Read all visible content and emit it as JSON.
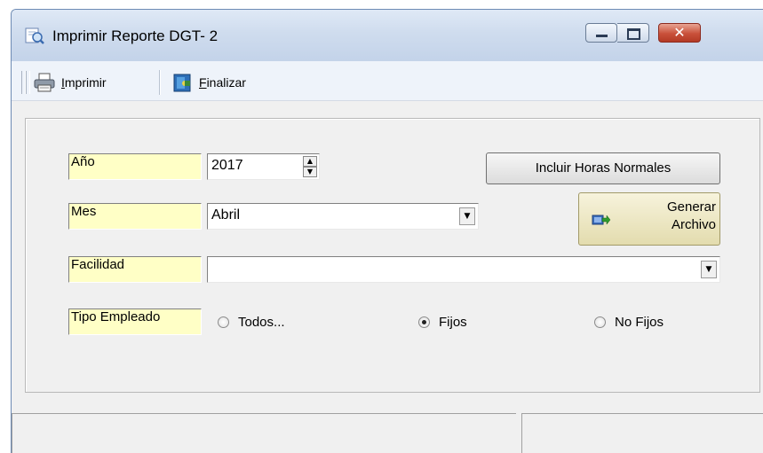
{
  "window": {
    "title": "Imprimir Reporte DGT- 2",
    "controls": {
      "minimize": "minimize",
      "maximize": "maximize",
      "close": "close"
    }
  },
  "toolbar": {
    "print": {
      "label_hotkey": "I",
      "label_rest": "mprimir",
      "icon": "printer-icon"
    },
    "finish": {
      "label_hotkey": "F",
      "label_rest": "inalizar",
      "icon": "exit-door-icon"
    }
  },
  "form": {
    "year": {
      "label": "Año",
      "value": "2017"
    },
    "month": {
      "label": "Mes",
      "value": "Abril"
    },
    "facility": {
      "label": "Facilidad",
      "value": ""
    },
    "employee_type": {
      "label": "Tipo Empleado",
      "options": [
        {
          "label": "Todos...",
          "selected": false
        },
        {
          "label": "Fijos",
          "selected": true
        },
        {
          "label": "No Fijos",
          "selected": false
        }
      ]
    },
    "include_normal_hours_button": "Incluir Horas Normales",
    "generate_file_button": {
      "line1": "Generar",
      "line2": "Archivo"
    }
  },
  "colors": {
    "label_bg": "#ffffc6",
    "title_bg": "#cfdcee",
    "close_bg": "#c9503a"
  }
}
